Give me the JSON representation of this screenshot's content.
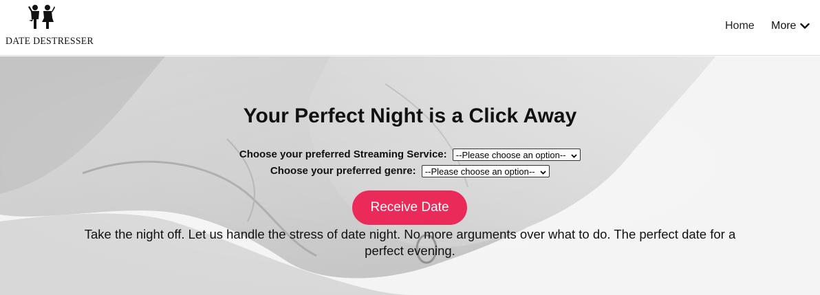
{
  "header": {
    "logo_text": "DATE DESTRESSER",
    "nav": {
      "home": "Home",
      "more": "More"
    }
  },
  "hero": {
    "title": "Your Perfect Night is a Click Away",
    "streaming_label": "Choose your preferred Streaming Service:",
    "streaming_select": "--Please choose an option--",
    "genre_label": "Choose your preferred genre:",
    "genre_select": "--Please choose an option--",
    "cta_label": "Receive Date",
    "tagline": "Take the night off. Let us handle the stress of date night. No more arguments over what to do. The perfect date for a perfect evening."
  },
  "colors": {
    "accent": "#ea2a59",
    "background_image": "grayscale holding hands"
  },
  "icons": {
    "logo": "couple-icon",
    "more": "chevron-down-icon",
    "select": "chevron-down-icon"
  }
}
